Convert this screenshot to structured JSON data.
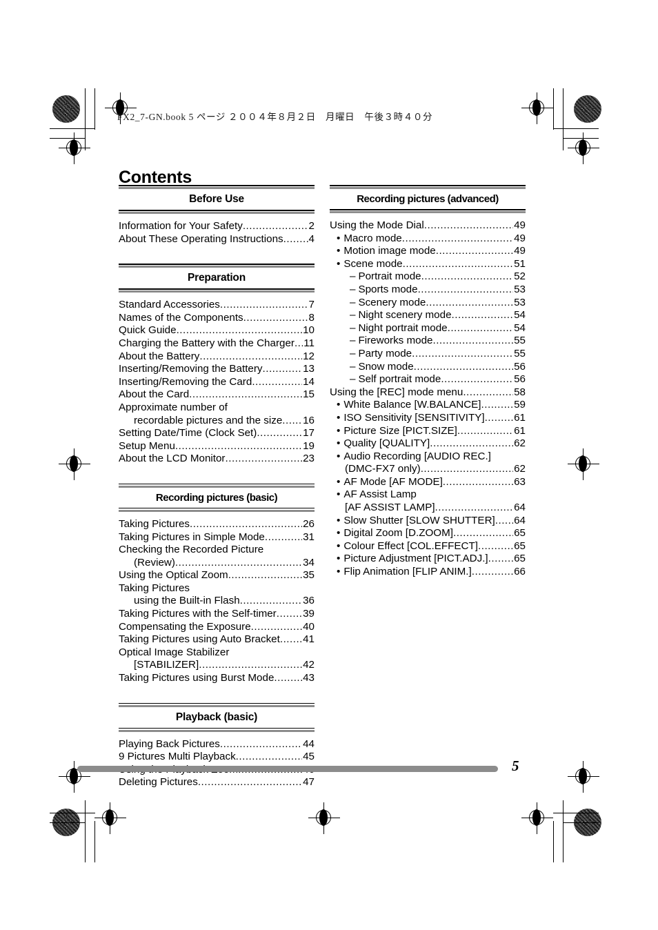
{
  "stamp": "FX2_7-GN.book  5 ページ  ２００４年８月２日　月曜日　午後３時４０分",
  "page_title": "Contents",
  "page_number": "5",
  "symbols": {
    "bullet": "•",
    "dash": "–"
  },
  "colors": {
    "rule_dark": "#000000",
    "rule_gray": "#8c8c8c",
    "text": "#000000"
  },
  "columns": {
    "left": [
      {
        "title": "Before Use",
        "entries": [
          {
            "label": "Information for Your Safety",
            "page": "2",
            "level": 1
          },
          {
            "label": "About These Operating Instructions",
            "page": "4",
            "level": 1
          }
        ]
      },
      {
        "title": "Preparation",
        "entries": [
          {
            "label": "Standard Accessories",
            "page": "7",
            "level": 1
          },
          {
            "label": "Names of the Components",
            "page": "8",
            "level": 1
          },
          {
            "label": "Quick Guide",
            "page": "10",
            "level": 1
          },
          {
            "label": "Charging the Battery with the Charger",
            "page": "11",
            "level": 1
          },
          {
            "label": "About the Battery",
            "page": "12",
            "level": 1
          },
          {
            "label": "Inserting/Removing the Battery",
            "page": "13",
            "level": 1
          },
          {
            "label": "Inserting/Removing the Card",
            "page": "14",
            "level": 1
          },
          {
            "label": "About the Card",
            "page": "15",
            "level": 1
          },
          {
            "label": "Approximate number of",
            "page": "",
            "level": 1,
            "leader": false
          },
          {
            "label": "recordable pictures and the size",
            "page": "16",
            "level": "1c"
          },
          {
            "label": "Setting Date/Time (Clock Set)",
            "page": "17",
            "level": 1
          },
          {
            "label": "Setup Menu",
            "page": "19",
            "level": 1
          },
          {
            "label": "About the LCD Monitor",
            "page": "23",
            "level": 1
          }
        ]
      },
      {
        "title": "Recording pictures (basic)",
        "entries": [
          {
            "label": "Taking Pictures",
            "page": "26",
            "level": 1
          },
          {
            "label": "Taking Pictures in Simple Mode",
            "page": "31",
            "level": 1
          },
          {
            "label": "Checking the Recorded Picture",
            "page": "",
            "level": 1,
            "leader": false
          },
          {
            "label": "(Review)",
            "page": "34",
            "level": "1c"
          },
          {
            "label": "Using the Optical Zoom",
            "page": "35",
            "level": 1
          },
          {
            "label": "Taking Pictures",
            "page": "",
            "level": 1,
            "leader": false
          },
          {
            "label": "using the Built-in Flash",
            "page": "36",
            "level": "1c"
          },
          {
            "label": "Taking Pictures with the Self-timer",
            "page": "39",
            "level": 1
          },
          {
            "label": "Compensating the Exposure",
            "page": "40",
            "level": 1
          },
          {
            "label": "Taking Pictures using Auto Bracket",
            "page": "41",
            "level": 1
          },
          {
            "label": "Optical Image Stabilizer",
            "page": "",
            "level": 1,
            "leader": false
          },
          {
            "label": "[STABILIZER]",
            "page": "42",
            "level": "1c"
          },
          {
            "label": "Taking Pictures using Burst Mode",
            "page": "43",
            "level": 1
          }
        ]
      },
      {
        "title": "Playback (basic)",
        "entries": [
          {
            "label": "Playing Back Pictures",
            "page": "44",
            "level": 1
          },
          {
            "label": "9 Pictures Multi Playback",
            "page": "45",
            "level": 1
          },
          {
            "label": "Using the Playback Zoom",
            "page": "46",
            "level": 1
          },
          {
            "label": "Deleting Pictures",
            "page": "47",
            "level": 1
          }
        ]
      }
    ],
    "right": [
      {
        "title": "Recording pictures (advanced)",
        "entries": [
          {
            "label": "Using the Mode Dial",
            "page": "49",
            "level": 1
          },
          {
            "label": "Macro mode",
            "page": "49",
            "level": 2
          },
          {
            "label": "Motion image mode",
            "page": "49",
            "level": 2
          },
          {
            "label": "Scene mode",
            "page": "51",
            "level": 2
          },
          {
            "label": "Portrait mode",
            "page": "52",
            "level": 3
          },
          {
            "label": "Sports mode",
            "page": "53",
            "level": 3
          },
          {
            "label": "Scenery mode",
            "page": "53",
            "level": 3
          },
          {
            "label": "Night scenery mode",
            "page": "54",
            "level": 3
          },
          {
            "label": "Night portrait mode",
            "page": "54",
            "level": 3
          },
          {
            "label": "Fireworks mode",
            "page": "55",
            "level": 3
          },
          {
            "label": "Party mode",
            "page": "55",
            "level": 3
          },
          {
            "label": "Snow mode",
            "page": "56",
            "level": 3
          },
          {
            "label": "Self portrait mode",
            "page": "56",
            "level": 3
          },
          {
            "label": "Using the [REC] mode menu",
            "page": "58",
            "level": 1
          },
          {
            "label": "White Balance [W.BALANCE]",
            "page": "59",
            "level": 2
          },
          {
            "label": "ISO Sensitivity [SENSITIVITY]",
            "page": "61",
            "level": 2
          },
          {
            "label": "Picture Size [PICT.SIZE]",
            "page": "61",
            "level": 2
          },
          {
            "label": "Quality [QUALITY]",
            "page": "62",
            "level": 2
          },
          {
            "label": "Audio Recording [AUDIO REC.]",
            "page": "",
            "level": 2,
            "leader": false
          },
          {
            "label": "(DMC-FX7 only)",
            "page": "62",
            "level": "2c"
          },
          {
            "label": "AF Mode [AF MODE]",
            "page": "63",
            "level": 2
          },
          {
            "label": "AF Assist Lamp",
            "page": "",
            "level": 2,
            "leader": false
          },
          {
            "label": "[AF ASSIST LAMP]",
            "page": "64",
            "level": "2c"
          },
          {
            "label": "Slow Shutter [SLOW SHUTTER]",
            "page": "64",
            "level": 2
          },
          {
            "label": "Digital Zoom [D.ZOOM]",
            "page": "65",
            "level": 2
          },
          {
            "label": "Colour Effect [COL.EFFECT]",
            "page": "65",
            "level": 2
          },
          {
            "label": "Picture Adjustment [PICT.ADJ.]",
            "page": "65",
            "level": 2
          },
          {
            "label": "Flip Animation [FLIP ANIM.]",
            "page": "66",
            "level": 2
          }
        ]
      }
    ]
  }
}
